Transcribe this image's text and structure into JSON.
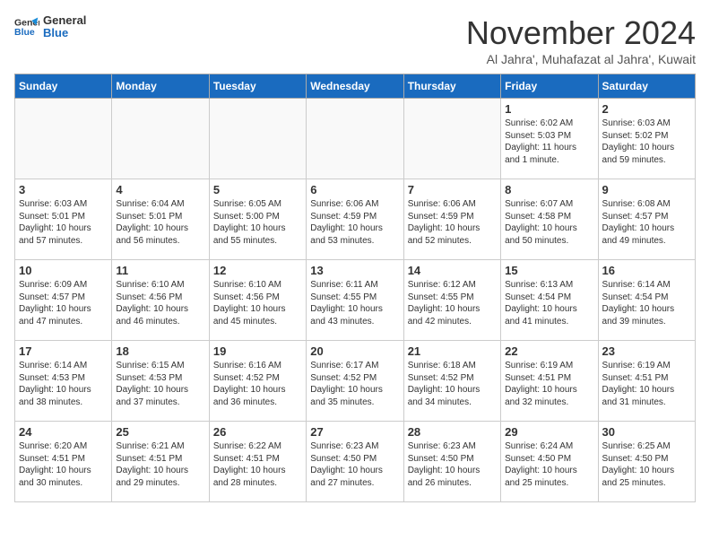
{
  "header": {
    "logo_line1": "General",
    "logo_line2": "Blue",
    "month": "November 2024",
    "location": "Al Jahra', Muhafazat al Jahra', Kuwait"
  },
  "weekdays": [
    "Sunday",
    "Monday",
    "Tuesday",
    "Wednesday",
    "Thursday",
    "Friday",
    "Saturday"
  ],
  "weeks": [
    [
      {
        "day": "",
        "info": ""
      },
      {
        "day": "",
        "info": ""
      },
      {
        "day": "",
        "info": ""
      },
      {
        "day": "",
        "info": ""
      },
      {
        "day": "",
        "info": ""
      },
      {
        "day": "1",
        "info": "Sunrise: 6:02 AM\nSunset: 5:03 PM\nDaylight: 11 hours\nand 1 minute."
      },
      {
        "day": "2",
        "info": "Sunrise: 6:03 AM\nSunset: 5:02 PM\nDaylight: 10 hours\nand 59 minutes."
      }
    ],
    [
      {
        "day": "3",
        "info": "Sunrise: 6:03 AM\nSunset: 5:01 PM\nDaylight: 10 hours\nand 57 minutes."
      },
      {
        "day": "4",
        "info": "Sunrise: 6:04 AM\nSunset: 5:01 PM\nDaylight: 10 hours\nand 56 minutes."
      },
      {
        "day": "5",
        "info": "Sunrise: 6:05 AM\nSunset: 5:00 PM\nDaylight: 10 hours\nand 55 minutes."
      },
      {
        "day": "6",
        "info": "Sunrise: 6:06 AM\nSunset: 4:59 PM\nDaylight: 10 hours\nand 53 minutes."
      },
      {
        "day": "7",
        "info": "Sunrise: 6:06 AM\nSunset: 4:59 PM\nDaylight: 10 hours\nand 52 minutes."
      },
      {
        "day": "8",
        "info": "Sunrise: 6:07 AM\nSunset: 4:58 PM\nDaylight: 10 hours\nand 50 minutes."
      },
      {
        "day": "9",
        "info": "Sunrise: 6:08 AM\nSunset: 4:57 PM\nDaylight: 10 hours\nand 49 minutes."
      }
    ],
    [
      {
        "day": "10",
        "info": "Sunrise: 6:09 AM\nSunset: 4:57 PM\nDaylight: 10 hours\nand 47 minutes."
      },
      {
        "day": "11",
        "info": "Sunrise: 6:10 AM\nSunset: 4:56 PM\nDaylight: 10 hours\nand 46 minutes."
      },
      {
        "day": "12",
        "info": "Sunrise: 6:10 AM\nSunset: 4:56 PM\nDaylight: 10 hours\nand 45 minutes."
      },
      {
        "day": "13",
        "info": "Sunrise: 6:11 AM\nSunset: 4:55 PM\nDaylight: 10 hours\nand 43 minutes."
      },
      {
        "day": "14",
        "info": "Sunrise: 6:12 AM\nSunset: 4:55 PM\nDaylight: 10 hours\nand 42 minutes."
      },
      {
        "day": "15",
        "info": "Sunrise: 6:13 AM\nSunset: 4:54 PM\nDaylight: 10 hours\nand 41 minutes."
      },
      {
        "day": "16",
        "info": "Sunrise: 6:14 AM\nSunset: 4:54 PM\nDaylight: 10 hours\nand 39 minutes."
      }
    ],
    [
      {
        "day": "17",
        "info": "Sunrise: 6:14 AM\nSunset: 4:53 PM\nDaylight: 10 hours\nand 38 minutes."
      },
      {
        "day": "18",
        "info": "Sunrise: 6:15 AM\nSunset: 4:53 PM\nDaylight: 10 hours\nand 37 minutes."
      },
      {
        "day": "19",
        "info": "Sunrise: 6:16 AM\nSunset: 4:52 PM\nDaylight: 10 hours\nand 36 minutes."
      },
      {
        "day": "20",
        "info": "Sunrise: 6:17 AM\nSunset: 4:52 PM\nDaylight: 10 hours\nand 35 minutes."
      },
      {
        "day": "21",
        "info": "Sunrise: 6:18 AM\nSunset: 4:52 PM\nDaylight: 10 hours\nand 34 minutes."
      },
      {
        "day": "22",
        "info": "Sunrise: 6:19 AM\nSunset: 4:51 PM\nDaylight: 10 hours\nand 32 minutes."
      },
      {
        "day": "23",
        "info": "Sunrise: 6:19 AM\nSunset: 4:51 PM\nDaylight: 10 hours\nand 31 minutes."
      }
    ],
    [
      {
        "day": "24",
        "info": "Sunrise: 6:20 AM\nSunset: 4:51 PM\nDaylight: 10 hours\nand 30 minutes."
      },
      {
        "day": "25",
        "info": "Sunrise: 6:21 AM\nSunset: 4:51 PM\nDaylight: 10 hours\nand 29 minutes."
      },
      {
        "day": "26",
        "info": "Sunrise: 6:22 AM\nSunset: 4:51 PM\nDaylight: 10 hours\nand 28 minutes."
      },
      {
        "day": "27",
        "info": "Sunrise: 6:23 AM\nSunset: 4:50 PM\nDaylight: 10 hours\nand 27 minutes."
      },
      {
        "day": "28",
        "info": "Sunrise: 6:23 AM\nSunset: 4:50 PM\nDaylight: 10 hours\nand 26 minutes."
      },
      {
        "day": "29",
        "info": "Sunrise: 6:24 AM\nSunset: 4:50 PM\nDaylight: 10 hours\nand 25 minutes."
      },
      {
        "day": "30",
        "info": "Sunrise: 6:25 AM\nSunset: 4:50 PM\nDaylight: 10 hours\nand 25 minutes."
      }
    ]
  ]
}
